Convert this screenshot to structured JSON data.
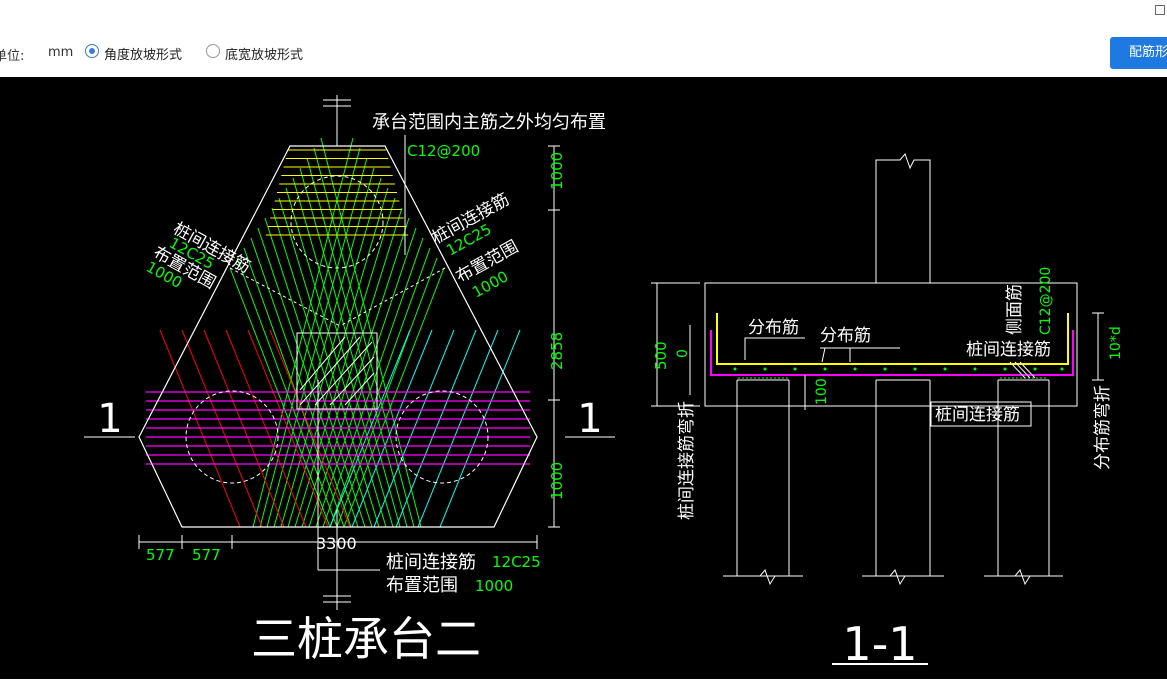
{
  "toolbar": {
    "unit_label": "单位:",
    "unit_value": "mm",
    "radio_options": [
      {
        "label": "角度放坡形式",
        "checked": true
      },
      {
        "label": "底宽放坡形式",
        "checked": false
      }
    ],
    "primary_button_label": "配筋形"
  },
  "drawing": {
    "left": {
      "title": "三桩承台二",
      "section_mark": "1",
      "note_top": "承台范围内主筋之外均匀布置",
      "note_top_spec": "C12@200",
      "label_left_line1": "桩间连接筋",
      "label_left_spec": "12C25",
      "label_left_line2": "布置范围",
      "label_left_range": "1000",
      "label_right_line1": "桩间连接筋",
      "label_right_spec": "12C25",
      "label_right_line2": "布置范围",
      "label_right_range": "1000",
      "label_bottom_line1": "桩间连接筋",
      "label_bottom_spec": "12C25",
      "label_bottom_line2": "布置范围",
      "label_bottom_range": "1000",
      "dim_top": "1000",
      "dim_middle": "2858",
      "dim_bottom": "1000",
      "dim_b1": "577",
      "dim_b2": "577",
      "dim_total": "3300"
    },
    "right": {
      "title": "1-1",
      "label_distribution_1": "分布筋",
      "label_distribution_2": "分布筋",
      "label_side": "侧面筋",
      "label_side_spec": "C12@200",
      "label_pile_conn_1": "桩间连接筋",
      "label_pile_conn_2": "桩间连接筋",
      "label_bend_left": "桩间连接筋弯折",
      "label_bend_right": "分布筋弯折",
      "dim_500": "500",
      "dim_0": "0",
      "dim_100": "100",
      "dim_10d": "10*d"
    }
  },
  "colors": {
    "canvas_bg": "#000000",
    "line_white": "#ffffff",
    "yellow": "#ffff00",
    "green": "#00ff00",
    "magenta": "#ff00ff",
    "red": "#ff0000",
    "cyan": "#00ffff",
    "button_blue": "#1e7ae0",
    "radio_blue": "#3a7bd5"
  }
}
